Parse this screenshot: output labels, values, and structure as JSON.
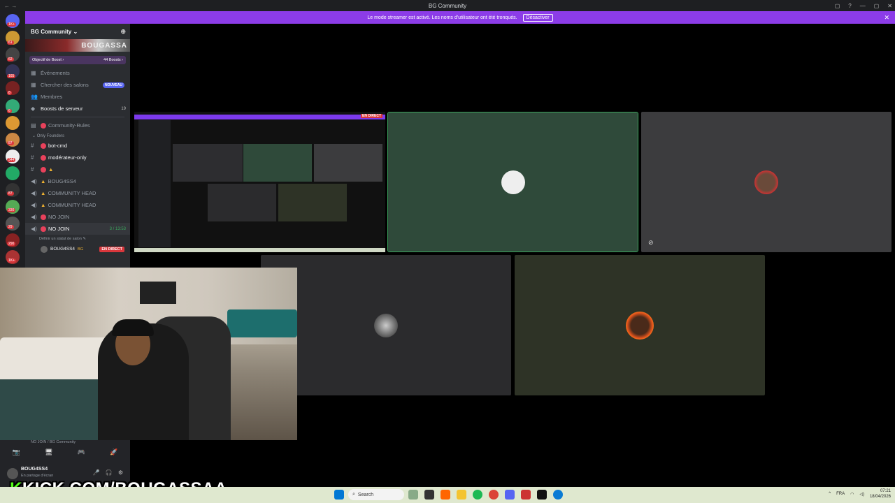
{
  "window": {
    "title": "BG Community",
    "nav": "← →",
    "controls": [
      "▢",
      "?",
      "—",
      "▢",
      "✕"
    ]
  },
  "streamer_bar": {
    "message": "Le mode streamer est activé. Les noms d'utilisateur ont été tronqués.",
    "button": "Désactiver",
    "close": "✕"
  },
  "server_badges": [
    "1K+",
    "61",
    "62",
    "165",
    "8",
    "6",
    "",
    "87",
    "344",
    "",
    "87",
    "",
    "330",
    "29",
    "290",
    "1K+"
  ],
  "sidebar": {
    "guild_name": "BG Community ⌄",
    "banner_text": "BOUGASSA",
    "boost": {
      "label": "Objectif de Boost ›",
      "count": "44 Boosts ›"
    },
    "items": [
      {
        "label": "Événements",
        "icon": "▦"
      },
      {
        "label": "Chercher des salons",
        "icon": "▦",
        "badge": "NOUVEAU"
      },
      {
        "label": "Membres",
        "icon": "👥"
      },
      {
        "label": "Boosts de serveur",
        "icon": "◆",
        "count": "19"
      }
    ],
    "rules_channel": "Community-Rules",
    "category": "⌄ Only Founders",
    "channels": [
      {
        "label": "bot-cmd",
        "type": "text",
        "prefix": "red"
      },
      {
        "label": "modérateur-only",
        "type": "text",
        "prefix": "red"
      },
      {
        "label": "",
        "type": "text",
        "prefix": "red-warn"
      },
      {
        "label": "BOUG4SS4",
        "type": "voice",
        "prefix": "warn"
      },
      {
        "label": "COMMUNITY HEAD",
        "type": "voice",
        "prefix": "warn"
      },
      {
        "label": "COMMUNITY HEAD",
        "type": "voice",
        "prefix": "warn"
      },
      {
        "label": "NO JOIN",
        "type": "voice",
        "prefix": "red"
      },
      {
        "label": "NO JOIN",
        "type": "voice",
        "prefix": "red",
        "count": "3 / 13:53"
      }
    ],
    "status_hint": "Définir un statut de salon ✎",
    "voice_user": {
      "name": "BOUG4SS4",
      "tag": "BG",
      "live": "EN DIRECT"
    }
  },
  "stage": {
    "screenshare_live": "EN DIRECT"
  },
  "user_panel": {
    "channel_path": "NO JOIN / BG Community",
    "name": "BOUG4SS4",
    "status": "En partage d'écran",
    "buttons": [
      "📷",
      "🖥",
      "🎮",
      "🚀"
    ],
    "controls": [
      "🎤",
      "🎧",
      "⚙"
    ]
  },
  "overlay": {
    "kick_k": "K",
    "kick_rest": "KICK.COM/BOUGASSAA"
  },
  "taskbar": {
    "search": "Search",
    "lang": "FRA",
    "time": "07:21",
    "date": "18/04/2026"
  },
  "colors": {
    "accent": "#8c3ce8",
    "speaking": "#3ba55d",
    "live": "#da373c",
    "kick": "#53fc18"
  }
}
